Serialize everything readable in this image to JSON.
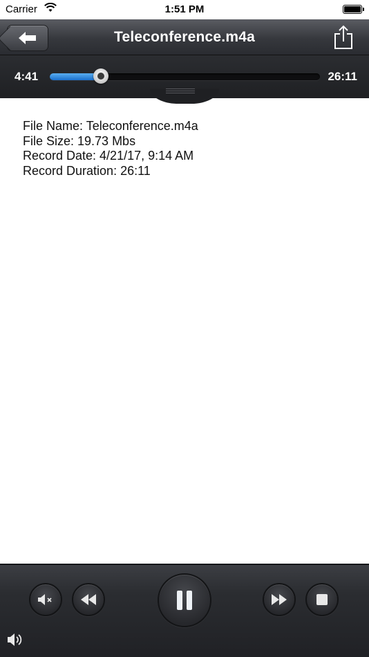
{
  "status_bar": {
    "carrier": "Carrier",
    "time": "1:51 PM"
  },
  "nav": {
    "title": "Teleconference.m4a",
    "back_icon": "back-arrow-icon",
    "share_icon": "share-icon"
  },
  "player": {
    "elapsed": "4:41",
    "total": "26:11",
    "progress_fraction": 0.179,
    "accent": "#2a85e0"
  },
  "info": {
    "file_name": "File Name: Teleconference.m4a",
    "file_size": "File Size: 19.73 Mbs",
    "record_date": "Record Date: 4/21/17, 9:14 AM",
    "record_duration": "Record Duration: 26:11"
  },
  "controls": {
    "mute_icon": "mute-icon",
    "rewind_icon": "rewind-icon",
    "pause_icon": "pause-icon",
    "fast_forward_icon": "fast-forward-icon",
    "stop_icon": "stop-icon",
    "volume_icon": "volume-icon"
  }
}
